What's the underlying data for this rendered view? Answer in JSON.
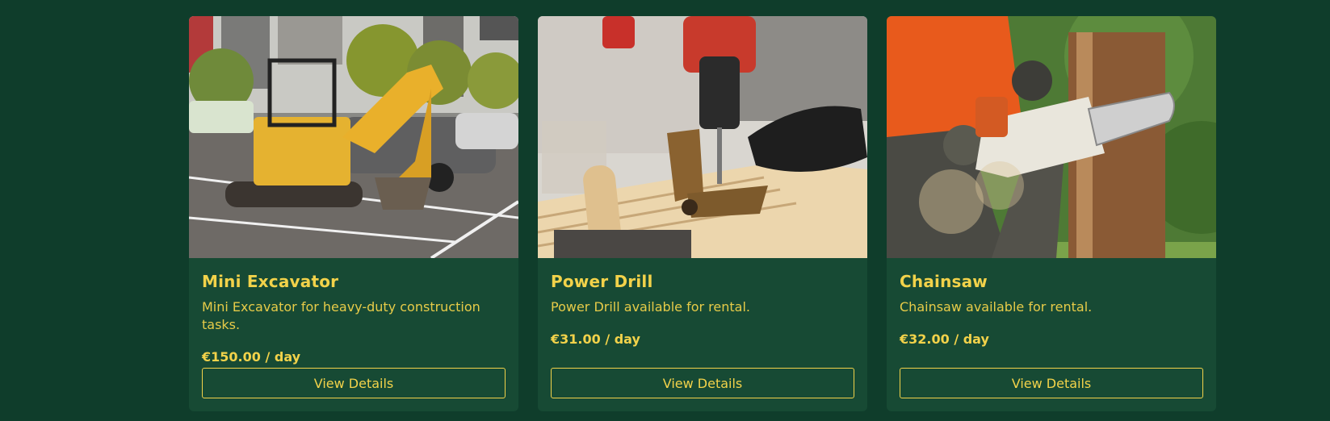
{
  "products": [
    {
      "title": "Mini Excavator",
      "description": "Mini Excavator for heavy-duty construction tasks.",
      "price": "€150.00 / day",
      "button_label": "View Details",
      "image_icon": "excavator-photo"
    },
    {
      "title": "Power Drill",
      "description": "Power Drill available for rental.",
      "price": "€31.00 / day",
      "button_label": "View Details",
      "image_icon": "power-drill-photo"
    },
    {
      "title": "Chainsaw",
      "description": "Chainsaw available for rental.",
      "price": "€32.00 / day",
      "button_label": "View Details",
      "image_icon": "chainsaw-photo"
    }
  ],
  "colors": {
    "page_background": "#0f3d2b",
    "card_background": "#174a34",
    "accent": "#f2d24a"
  }
}
